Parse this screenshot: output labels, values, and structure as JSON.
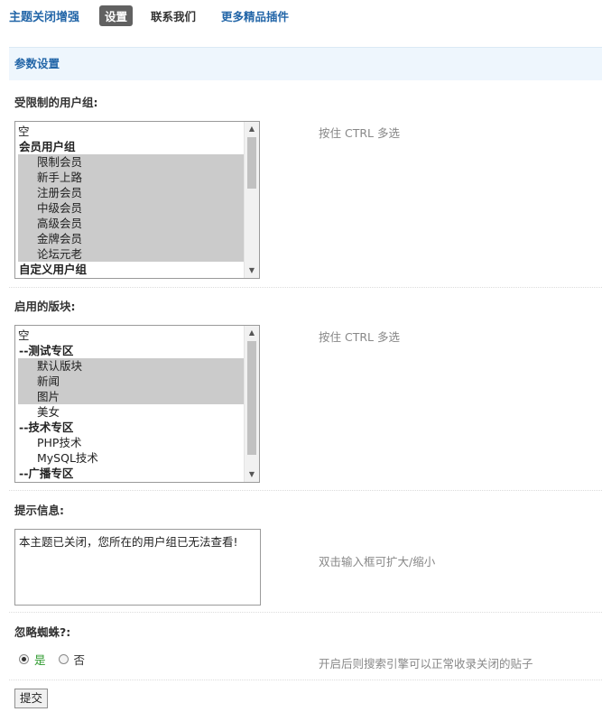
{
  "header": {
    "plugin_title": "主题关闭增强",
    "tabs": [
      {
        "label": "设置",
        "active": true
      },
      {
        "label": "联系我们",
        "active": false
      }
    ],
    "more_link": "更多精品插件"
  },
  "section_title": "参数设置",
  "restricted_groups": {
    "label": "受限制的用户组:",
    "hint": "按住 CTRL 多选",
    "options": [
      {
        "text": "空",
        "type": "plain",
        "selected": false
      },
      {
        "text": "会员用户组",
        "type": "group",
        "selected": false
      },
      {
        "text": "限制会员",
        "type": "child",
        "selected": true
      },
      {
        "text": "新手上路",
        "type": "child",
        "selected": true
      },
      {
        "text": "注册会员",
        "type": "child",
        "selected": true
      },
      {
        "text": "中级会员",
        "type": "child",
        "selected": true
      },
      {
        "text": "高级会员",
        "type": "child",
        "selected": true
      },
      {
        "text": "金牌会员",
        "type": "child",
        "selected": true
      },
      {
        "text": "论坛元老",
        "type": "child",
        "selected": true
      },
      {
        "text": "自定义用户组",
        "type": "group",
        "selected": false
      }
    ]
  },
  "enabled_forums": {
    "label": "启用的版块:",
    "hint": "按住 CTRL 多选",
    "options": [
      {
        "text": "空",
        "type": "plain",
        "selected": false
      },
      {
        "text": "--测试专区",
        "type": "group",
        "selected": false
      },
      {
        "text": "默认版块",
        "type": "child",
        "selected": true
      },
      {
        "text": "新闻",
        "type": "child",
        "selected": true
      },
      {
        "text": "图片",
        "type": "child",
        "selected": true
      },
      {
        "text": "美女",
        "type": "child",
        "selected": false
      },
      {
        "text": "--技术专区",
        "type": "group",
        "selected": false
      },
      {
        "text": "PHP技术",
        "type": "child",
        "selected": false
      },
      {
        "text": "MySQL技术",
        "type": "child",
        "selected": false
      },
      {
        "text": "--广播专区",
        "type": "group",
        "selected": false
      }
    ]
  },
  "tip_message": {
    "label": "提示信息:",
    "value": "本主题已关闭，您所在的用户组已无法查看!",
    "hint": "双击输入框可扩大/缩小"
  },
  "ignore_spider": {
    "label": "忽略蜘蛛?:",
    "options": [
      {
        "text": "是",
        "checked": true
      },
      {
        "text": "否",
        "checked": false
      }
    ],
    "hint": "开启后则搜索引擎可以正常收录关闭的贴子"
  },
  "submit_label": "提交"
}
